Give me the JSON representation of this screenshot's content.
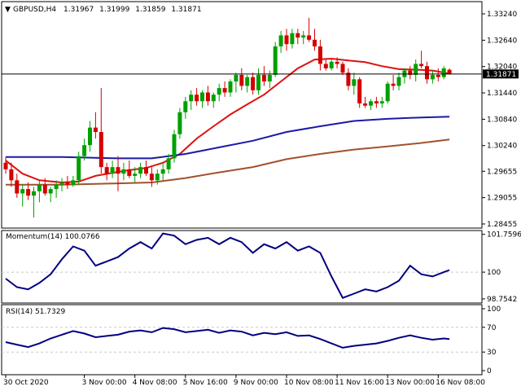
{
  "header": {
    "symbol": "GBPUSD,H4",
    "open": "1.31967",
    "high": "1.31999",
    "low": "1.31859",
    "close": "1.31871"
  },
  "price_box": "1.31871",
  "colors": {
    "bull": "#00a000",
    "bear": "#d40000",
    "ma_fast": "#e01010",
    "ma_mid": "#1a1aa6",
    "ma_slow": "#a0522d",
    "indicator": "#000080",
    "grid": "#c8c8c8",
    "frame": "#000000"
  },
  "chart_data": [
    {
      "type": "candlestick",
      "panel": "price",
      "symbol": "GBPUSD",
      "timeframe": "H4",
      "ylim": [
        1.2838,
        1.335
      ],
      "yticks": [
        "1.33240",
        "1.32640",
        "1.32040",
        "1.31440",
        "1.30840",
        "1.30240",
        "1.29655",
        "1.29055",
        "1.28455"
      ],
      "current_price": 1.31871,
      "xticks": [
        {
          "label": "30 Oct 2020",
          "index": 0
        },
        {
          "label": "3 Nov 00:00",
          "index": 14
        },
        {
          "label": "4 Nov 08:00",
          "index": 23
        },
        {
          "label": "5 Nov 16:00",
          "index": 32
        },
        {
          "label": "9 Nov 00:00",
          "index": 41
        },
        {
          "label": "10 Nov 08:00",
          "index": 50
        },
        {
          "label": "11 Nov 16:00",
          "index": 59
        },
        {
          "label": "13 Nov 00:00",
          "index": 68
        },
        {
          "label": "16 Nov 08:00",
          "index": 77
        }
      ],
      "candles": [
        {
          "o": 1.2985,
          "h": 1.2998,
          "l": 1.296,
          "c": 1.297
        },
        {
          "o": 1.297,
          "h": 1.2985,
          "l": 1.293,
          "c": 1.2945
        },
        {
          "o": 1.2945,
          "h": 1.296,
          "l": 1.2905,
          "c": 1.2915
        },
        {
          "o": 1.2915,
          "h": 1.2935,
          "l": 1.2885,
          "c": 1.2925
        },
        {
          "o": 1.2925,
          "h": 1.294,
          "l": 1.29,
          "c": 1.291
        },
        {
          "o": 1.291,
          "h": 1.293,
          "l": 1.286,
          "c": 1.292
        },
        {
          "o": 1.292,
          "h": 1.2945,
          "l": 1.2895,
          "c": 1.2935
        },
        {
          "o": 1.2935,
          "h": 1.295,
          "l": 1.291,
          "c": 1.2915
        },
        {
          "o": 1.2915,
          "h": 1.293,
          "l": 1.2895,
          "c": 1.2925
        },
        {
          "o": 1.2925,
          "h": 1.2945,
          "l": 1.2905,
          "c": 1.2935
        },
        {
          "o": 1.2935,
          "h": 1.295,
          "l": 1.292,
          "c": 1.294
        },
        {
          "o": 1.294,
          "h": 1.2955,
          "l": 1.2925,
          "c": 1.2935
        },
        {
          "o": 1.2935,
          "h": 1.2955,
          "l": 1.293,
          "c": 1.2945
        },
        {
          "o": 1.2945,
          "h": 1.301,
          "l": 1.2935,
          "c": 1.3
        },
        {
          "o": 1.3,
          "h": 1.304,
          "l": 1.299,
          "c": 1.3025
        },
        {
          "o": 1.3025,
          "h": 1.308,
          "l": 1.301,
          "c": 1.3065
        },
        {
          "o": 1.3065,
          "h": 1.31,
          "l": 1.304,
          "c": 1.3055
        },
        {
          "o": 1.3055,
          "h": 1.3155,
          "l": 1.296,
          "c": 1.2975
        },
        {
          "o": 1.2975,
          "h": 1.2985,
          "l": 1.2945,
          "c": 1.296
        },
        {
          "o": 1.296,
          "h": 1.299,
          "l": 1.295,
          "c": 1.2975
        },
        {
          "o": 1.2975,
          "h": 1.3,
          "l": 1.292,
          "c": 1.296
        },
        {
          "o": 1.296,
          "h": 1.2985,
          "l": 1.2945,
          "c": 1.297
        },
        {
          "o": 1.297,
          "h": 1.299,
          "l": 1.295,
          "c": 1.2955
        },
        {
          "o": 1.2955,
          "h": 1.2975,
          "l": 1.294,
          "c": 1.296
        },
        {
          "o": 1.296,
          "h": 1.2985,
          "l": 1.295,
          "c": 1.2975
        },
        {
          "o": 1.2975,
          "h": 1.299,
          "l": 1.2955,
          "c": 1.296
        },
        {
          "o": 1.296,
          "h": 1.2975,
          "l": 1.293,
          "c": 1.2945
        },
        {
          "o": 1.2945,
          "h": 1.297,
          "l": 1.2935,
          "c": 1.296
        },
        {
          "o": 1.296,
          "h": 1.2985,
          "l": 1.2945,
          "c": 1.297
        },
        {
          "o": 1.297,
          "h": 1.3005,
          "l": 1.296,
          "c": 1.2995
        },
        {
          "o": 1.2995,
          "h": 1.306,
          "l": 1.2985,
          "c": 1.305
        },
        {
          "o": 1.305,
          "h": 1.311,
          "l": 1.304,
          "c": 1.31
        },
        {
          "o": 1.31,
          "h": 1.3135,
          "l": 1.3085,
          "c": 1.3125
        },
        {
          "o": 1.3125,
          "h": 1.315,
          "l": 1.3105,
          "c": 1.314
        },
        {
          "o": 1.314,
          "h": 1.3155,
          "l": 1.3115,
          "c": 1.3125
        },
        {
          "o": 1.3125,
          "h": 1.315,
          "l": 1.311,
          "c": 1.3145
        },
        {
          "o": 1.3145,
          "h": 1.316,
          "l": 1.3115,
          "c": 1.3125
        },
        {
          "o": 1.3125,
          "h": 1.3145,
          "l": 1.311,
          "c": 1.314
        },
        {
          "o": 1.314,
          "h": 1.3165,
          "l": 1.3125,
          "c": 1.3155
        },
        {
          "o": 1.3155,
          "h": 1.317,
          "l": 1.3135,
          "c": 1.3145
        },
        {
          "o": 1.3145,
          "h": 1.3175,
          "l": 1.3135,
          "c": 1.317
        },
        {
          "o": 1.317,
          "h": 1.319,
          "l": 1.3145,
          "c": 1.3185
        },
        {
          "o": 1.3185,
          "h": 1.32,
          "l": 1.315,
          "c": 1.316
        },
        {
          "o": 1.316,
          "h": 1.3185,
          "l": 1.3145,
          "c": 1.318
        },
        {
          "o": 1.318,
          "h": 1.319,
          "l": 1.314,
          "c": 1.315
        },
        {
          "o": 1.315,
          "h": 1.32,
          "l": 1.314,
          "c": 1.3185
        },
        {
          "o": 1.3185,
          "h": 1.3205,
          "l": 1.316,
          "c": 1.317
        },
        {
          "o": 1.317,
          "h": 1.3195,
          "l": 1.3155,
          "c": 1.3185
        },
        {
          "o": 1.3185,
          "h": 1.326,
          "l": 1.318,
          "c": 1.325
        },
        {
          "o": 1.325,
          "h": 1.3285,
          "l": 1.3235,
          "c": 1.3275
        },
        {
          "o": 1.3275,
          "h": 1.329,
          "l": 1.324,
          "c": 1.3255
        },
        {
          "o": 1.3255,
          "h": 1.329,
          "l": 1.3245,
          "c": 1.328
        },
        {
          "o": 1.328,
          "h": 1.329,
          "l": 1.3255,
          "c": 1.327
        },
        {
          "o": 1.327,
          "h": 1.3285,
          "l": 1.3255,
          "c": 1.3275
        },
        {
          "o": 1.3275,
          "h": 1.3315,
          "l": 1.326,
          "c": 1.3265
        },
        {
          "o": 1.3265,
          "h": 1.329,
          "l": 1.324,
          "c": 1.325
        },
        {
          "o": 1.325,
          "h": 1.3265,
          "l": 1.3195,
          "c": 1.321
        },
        {
          "o": 1.321,
          "h": 1.322,
          "l": 1.3195,
          "c": 1.32
        },
        {
          "o": 1.32,
          "h": 1.322,
          "l": 1.3195,
          "c": 1.3215
        },
        {
          "o": 1.3215,
          "h": 1.3225,
          "l": 1.32,
          "c": 1.321
        },
        {
          "o": 1.321,
          "h": 1.3215,
          "l": 1.3185,
          "c": 1.319
        },
        {
          "o": 1.319,
          "h": 1.32,
          "l": 1.315,
          "c": 1.316
        },
        {
          "o": 1.316,
          "h": 1.319,
          "l": 1.314,
          "c": 1.3175
        },
        {
          "o": 1.3175,
          "h": 1.318,
          "l": 1.311,
          "c": 1.312
        },
        {
          "o": 1.312,
          "h": 1.3135,
          "l": 1.311,
          "c": 1.3115
        },
        {
          "o": 1.3115,
          "h": 1.313,
          "l": 1.3105,
          "c": 1.3125
        },
        {
          "o": 1.3125,
          "h": 1.3135,
          "l": 1.311,
          "c": 1.312
        },
        {
          "o": 1.312,
          "h": 1.3135,
          "l": 1.311,
          "c": 1.3125
        },
        {
          "o": 1.3125,
          "h": 1.317,
          "l": 1.312,
          "c": 1.3165
        },
        {
          "o": 1.3165,
          "h": 1.3185,
          "l": 1.315,
          "c": 1.316
        },
        {
          "o": 1.316,
          "h": 1.319,
          "l": 1.315,
          "c": 1.318
        },
        {
          "o": 1.318,
          "h": 1.32,
          "l": 1.3165,
          "c": 1.3195
        },
        {
          "o": 1.3195,
          "h": 1.3205,
          "l": 1.3175,
          "c": 1.3185
        },
        {
          "o": 1.3185,
          "h": 1.322,
          "l": 1.317,
          "c": 1.321
        },
        {
          "o": 1.321,
          "h": 1.324,
          "l": 1.32,
          "c": 1.3205
        },
        {
          "o": 1.3205,
          "h": 1.3215,
          "l": 1.3165,
          "c": 1.3175
        },
        {
          "o": 1.3175,
          "h": 1.3195,
          "l": 1.3165,
          "c": 1.3185
        },
        {
          "o": 1.3185,
          "h": 1.32,
          "l": 1.317,
          "c": 1.318
        },
        {
          "o": 1.318,
          "h": 1.3205,
          "l": 1.3175,
          "c": 1.32
        },
        {
          "o": 1.31967,
          "h": 1.31999,
          "l": 1.31859,
          "c": 1.31871
        }
      ],
      "overlays": [
        {
          "name": "fast",
          "color_key": "ma_fast",
          "points": [
            [
              0,
              1.299
            ],
            [
              3,
              1.296
            ],
            [
              6,
              1.2945
            ],
            [
              10,
              1.294
            ],
            [
              13,
              1.2942
            ],
            [
              16,
              1.2955
            ],
            [
              19,
              1.2962
            ],
            [
              22,
              1.2968
            ],
            [
              25,
              1.2973
            ],
            [
              28,
              1.2985
            ],
            [
              31,
              1.3005
            ],
            [
              34,
              1.304
            ],
            [
              37,
              1.3068
            ],
            [
              40,
              1.3095
            ],
            [
              43,
              1.3118
            ],
            [
              46,
              1.314
            ],
            [
              49,
              1.317
            ],
            [
              52,
              1.32
            ],
            [
              55,
              1.322
            ],
            [
              58,
              1.3222
            ],
            [
              61,
              1.3218
            ],
            [
              64,
              1.3214
            ],
            [
              67,
              1.3205
            ],
            [
              70,
              1.3198
            ],
            [
              73,
              1.3197
            ],
            [
              76,
              1.3195
            ],
            [
              79,
              1.3188
            ]
          ]
        },
        {
          "name": "mid",
          "color_key": "ma_mid",
          "points": [
            [
              0,
              1.2998
            ],
            [
              10,
              1.2998
            ],
            [
              20,
              1.2995
            ],
            [
              26,
              1.2995
            ],
            [
              32,
              1.3005
            ],
            [
              38,
              1.302
            ],
            [
              44,
              1.3035
            ],
            [
              50,
              1.3055
            ],
            [
              56,
              1.3068
            ],
            [
              62,
              1.308
            ],
            [
              68,
              1.3085
            ],
            [
              74,
              1.3088
            ],
            [
              79,
              1.309
            ]
          ]
        },
        {
          "name": "slow",
          "color_key": "ma_slow",
          "points": [
            [
              0,
              1.2935
            ],
            [
              10,
              1.2935
            ],
            [
              20,
              1.2938
            ],
            [
              26,
              1.294
            ],
            [
              32,
              1.295
            ],
            [
              38,
              1.2963
            ],
            [
              44,
              1.2975
            ],
            [
              50,
              1.2993
            ],
            [
              56,
              1.3005
            ],
            [
              62,
              1.3015
            ],
            [
              68,
              1.3022
            ],
            [
              74,
              1.303
            ],
            [
              79,
              1.3038
            ]
          ]
        }
      ]
    },
    {
      "type": "line",
      "panel": "momentum",
      "label": "Momentum(14) 100.0766",
      "ylim": [
        98.6,
        101.9
      ],
      "yticks": [
        "101.7596",
        "100",
        "98.7542"
      ],
      "reference": 100,
      "x": [
        0,
        2,
        4,
        6,
        8,
        10,
        12,
        14,
        16,
        18,
        20,
        22,
        24,
        26,
        28,
        30,
        32,
        34,
        36,
        38,
        40,
        42,
        44,
        46,
        48,
        50,
        52,
        54,
        56,
        58,
        60,
        62,
        64,
        66,
        68,
        70,
        72,
        74,
        76,
        78,
        79
      ],
      "y": [
        99.7,
        99.3,
        99.2,
        99.5,
        99.9,
        100.6,
        101.2,
        101.0,
        100.3,
        100.5,
        100.7,
        101.1,
        101.4,
        101.1,
        101.8,
        101.7,
        101.3,
        101.5,
        101.6,
        101.3,
        101.6,
        101.4,
        100.9,
        101.3,
        101.1,
        101.4,
        101.0,
        101.2,
        100.9,
        99.8,
        98.8,
        99.0,
        99.2,
        99.1,
        99.3,
        99.6,
        100.3,
        99.9,
        99.8,
        100.0,
        100.1
      ]
    },
    {
      "type": "line",
      "panel": "rsi",
      "label": "RSI(14) 51.7329",
      "ylim": [
        0,
        100
      ],
      "yticks": [
        "100",
        "70",
        "30",
        "0"
      ],
      "levels": [
        70,
        30
      ],
      "x": [
        0,
        2,
        4,
        6,
        8,
        10,
        12,
        14,
        16,
        18,
        20,
        22,
        24,
        26,
        28,
        30,
        32,
        34,
        36,
        38,
        40,
        42,
        44,
        46,
        48,
        50,
        52,
        54,
        56,
        58,
        60,
        62,
        64,
        66,
        68,
        70,
        72,
        74,
        76,
        78,
        79
      ],
      "y": [
        46,
        42,
        38,
        44,
        52,
        58,
        64,
        60,
        54,
        56,
        58,
        63,
        65,
        62,
        69,
        67,
        62,
        64,
        66,
        61,
        65,
        63,
        57,
        61,
        59,
        62,
        56,
        57,
        51,
        44,
        37,
        40,
        42,
        44,
        48,
        53,
        57,
        53,
        50,
        52,
        51
      ]
    }
  ]
}
